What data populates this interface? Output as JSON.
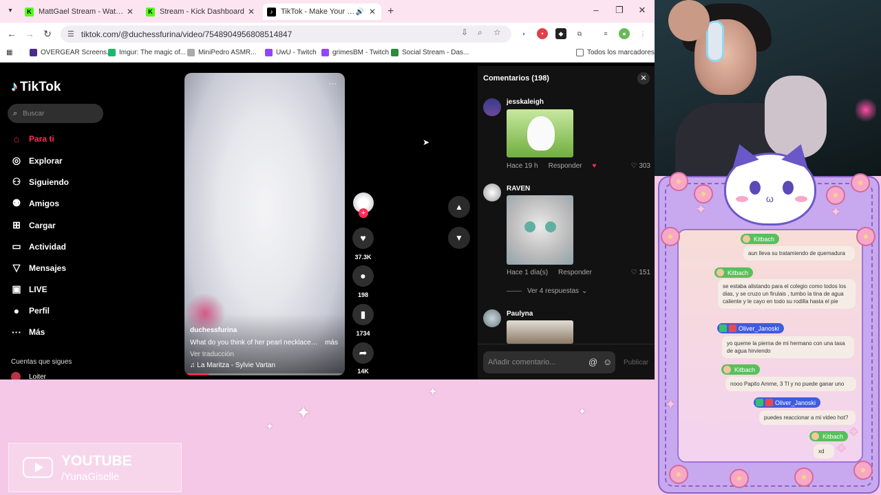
{
  "browser": {
    "tabs": [
      {
        "label": "MattGael Stream - Watch Live o",
        "icon": "kick-icon"
      },
      {
        "label": "Stream - Kick Dashboard",
        "icon": "kick-icon"
      },
      {
        "label": "TikTok - Make Your Day",
        "icon": "tiktok-icon",
        "active": true
      }
    ],
    "url": "tiktok.com/@duchessfurina/video/7548904956808514847",
    "bookmarks": [
      "OVERGEAR Screens...",
      "Imgur: The magic of...",
      "MiniPedro ASMR...",
      "UwU - Twitch",
      "grimesBM - Twitch",
      "Social Stream - Das...",
      "Todos los marcadores"
    ]
  },
  "tiktok": {
    "logo": "TikTok",
    "search_placeholder": "Buscar",
    "nav": [
      {
        "label": "Para ti",
        "icon": "home-icon",
        "active": true
      },
      {
        "label": "Explorar",
        "icon": "compass-icon"
      },
      {
        "label": "Siguiendo",
        "icon": "following-icon"
      },
      {
        "label": "Amigos",
        "icon": "friends-icon"
      },
      {
        "label": "Cargar",
        "icon": "upload-icon"
      },
      {
        "label": "Actividad",
        "icon": "activity-icon"
      },
      {
        "label": "Mensajes",
        "icon": "messages-icon"
      },
      {
        "label": "LIVE",
        "icon": "live-icon"
      },
      {
        "label": "Perfil",
        "icon": "profile-icon"
      },
      {
        "label": "Más",
        "icon": "more-icon"
      }
    ],
    "following_title": "Cuentas que sigues",
    "following": [
      "Loiter"
    ],
    "video": {
      "author": "duchessfurina",
      "description": "What do you think of her pearl necklaces ...",
      "more": "más",
      "translate": "Ver traducción",
      "music": "♫ La Maritza - Sylvie Vartan",
      "progress": 0.15
    },
    "actions": {
      "likes": "37.3K",
      "comments": "198",
      "saves": "1734",
      "shares": "14K"
    },
    "comments_panel": {
      "title": "Comentarios (198)",
      "input_placeholder": "Añadir comentario...",
      "post": "Publicar",
      "items": [
        {
          "user": "jesskaleigh",
          "time": "Hace 19 h",
          "reply": "Responder",
          "likes": "303"
        },
        {
          "user": "RAVEN",
          "time": "Hace 1 día(s)",
          "reply": "Responder",
          "likes": "151",
          "replies": "Ver 4 respuestas"
        },
        {
          "user": "Paulyna"
        }
      ]
    }
  },
  "overlay": {
    "chat": [
      {
        "name": "Kitbach",
        "color": "green",
        "msg": "aun lleva su tratamiendo de quemadura"
      },
      {
        "name": "Kitbach",
        "color": "green",
        "msg": "se estaba alistando para el colegio como todos los dias, y se cruzo un firulais , tumbo la tina de agua caliente y le cayo en todo su rodilla hasta el pie"
      },
      {
        "name": "Oliver_Janoski",
        "color": "blue",
        "msg": "yo queme la pierna de mi hermano con una tasa de agua hirviendo"
      },
      {
        "name": "Kitbach",
        "color": "green",
        "msg": "nooo Papito Amme, 3 Tl y no puede ganar uno"
      },
      {
        "name": "Oliver_Janoski",
        "color": "blue",
        "msg": "puedes reaccionar a mi video hot?"
      },
      {
        "name": "Kitbach",
        "color": "green",
        "msg": "xd"
      }
    ],
    "youtube": {
      "title": "YOUTUBE",
      "handle": "/YunaGiselle"
    }
  },
  "colors": {
    "tiktok_red": "#fe2c55",
    "kick_green": "#53fc18",
    "chat_green": "#57c05b",
    "chat_blue": "#3f5ce0"
  }
}
